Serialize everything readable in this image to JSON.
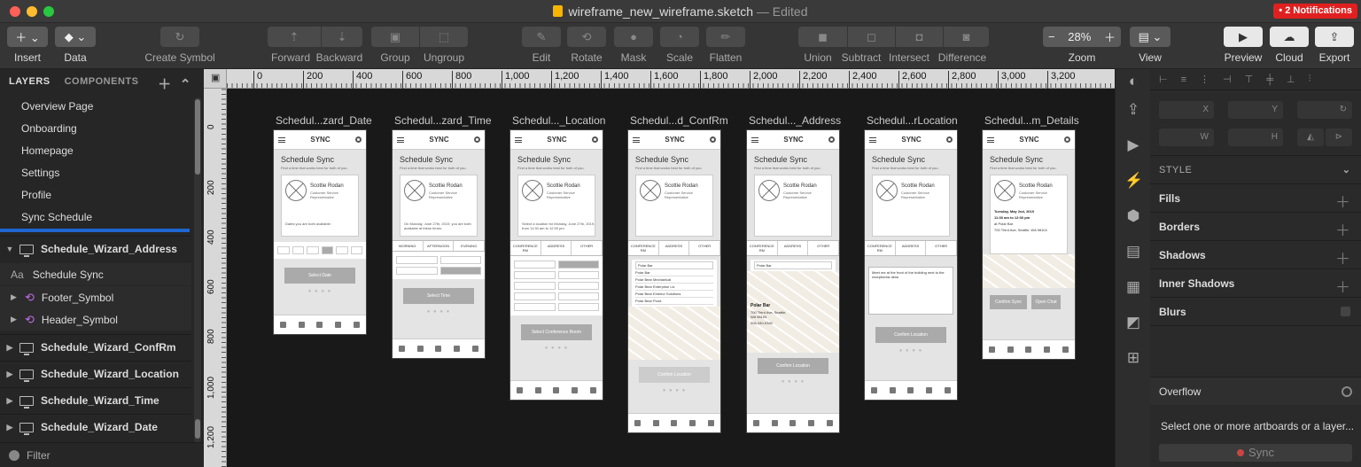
{
  "window": {
    "filename": "wireframe_new_wireframe.sketch",
    "status": "— Edited",
    "notifications": "• 2 Notifications"
  },
  "toolbar": {
    "insert": "Insert",
    "data": "Data",
    "create_symbol": "Create Symbol",
    "forward": "Forward",
    "backward": "Backward",
    "group": "Group",
    "ungroup": "Ungroup",
    "edit": "Edit",
    "rotate": "Rotate",
    "mask": "Mask",
    "scale": "Scale",
    "flatten": "Flatten",
    "union": "Union",
    "subtract": "Subtract",
    "intersect": "Intersect",
    "difference": "Difference",
    "zoom_label": "Zoom",
    "zoom_value": "28%",
    "view": "View",
    "preview": "Preview",
    "cloud": "Cloud",
    "export": "Export"
  },
  "layers_panel": {
    "tab_layers": "LAYERS",
    "tab_components": "COMPONENTS",
    "pages": [
      "Overview Page",
      "Onboarding",
      "Homepage",
      "Settings",
      "Profile",
      "Sync Schedule"
    ],
    "expanded_artboard": "Schedule_Wizard_Address",
    "children": [
      "Schedule Sync",
      "Footer_Symbol",
      "Header_Symbol"
    ],
    "artboards": [
      "Schedule_Wizard_ConfRm",
      "Schedule_Wizard_Location",
      "Schedule_Wizard_Time",
      "Schedule_Wizard_Date"
    ],
    "filter": "Filter"
  },
  "ruler": {
    "top": [
      "0",
      "200",
      "400",
      "600",
      "800",
      "1,000",
      "1,200",
      "1,400",
      "1,600",
      "1,800",
      "2,000",
      "2,200",
      "2,400",
      "2,600",
      "2,800",
      "3,000",
      "3,200"
    ],
    "left": [
      "0",
      "200",
      "400",
      "600",
      "800",
      "1,000",
      "1,200"
    ]
  },
  "artboards": [
    {
      "title": "Schedul...zard_Date"
    },
    {
      "title": "Schedul...zard_Time"
    },
    {
      "title": "Schedul..._Location"
    },
    {
      "title": "Schedul...d_ConfRm"
    },
    {
      "title": "Schedul..._Address"
    },
    {
      "title": "Schedul...rLocation"
    },
    {
      "title": "Schedul...m_Details"
    }
  ],
  "mock": {
    "app_name": "SYNC",
    "heading": "Schedule Sync",
    "subheading": "Find a time that works best for both of you.",
    "contact_name": "Scottie Rodan",
    "contact_role": "Customer Service Representative",
    "btn_select_date": "Select Date",
    "btn_select_time": "Select Time",
    "btn_select_room": "Select Conference Room",
    "btn_confirm_location": "Confirm Location",
    "btn_confirm_sync": "Confirm Sync",
    "btn_open_chat": "Open Chat",
    "date_note": "Dates you are both available:",
    "time_note": "On Monday, June 27th, 2019, you are both available at these times:",
    "location_note": "Select a location for Monday, June 27th, 2019, from 11:30 am to 12:00 pm",
    "tab_morning": "MORNING",
    "tab_afternoon": "AFTERNOON",
    "tab_evening": "EVENING",
    "tab_conf": "CONFERENCE RM",
    "tab_address": "ADDRESS",
    "tab_other": "OTHER",
    "search_value": "Polar Bar",
    "results": [
      "Polar Bar",
      "Polar Bear Mechanical",
      "Polar Bear Enterprise Llc",
      "Polar Bear Exterior Solutions",
      "Polar Bear Pond"
    ],
    "place_name": "Polar Bar",
    "place_addr": "700 Third Ave, Seattle, WA 98104",
    "place_phone": "206-340-0340",
    "other_note": "Meet me at the front of the building next to the receptionist desk.",
    "detail_date": "Tuesday, May 2nd, 2019",
    "detail_time": "11:30 am to 12:00 pm",
    "detail_place": "at Polar Bar",
    "detail_addr": "700 Third Ave, Seattle, WA 98104"
  },
  "inspector": {
    "x": "X",
    "y": "Y",
    "w": "W",
    "h": "H",
    "style": "STYLE",
    "fills": "Fills",
    "borders": "Borders",
    "shadows": "Shadows",
    "inner_shadows": "Inner Shadows",
    "blurs": "Blurs",
    "overflow": "Overflow",
    "select_msg": "Select one or more artboards or a layer...",
    "sync": "Sync"
  }
}
